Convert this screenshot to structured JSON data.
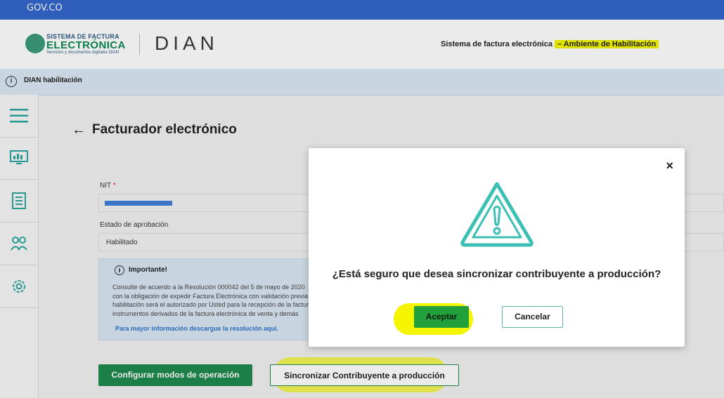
{
  "gov": {
    "label": "GOV.CO"
  },
  "header": {
    "brand_line1": "SISTEMA DE FACTURA",
    "brand_line2": "ELECTRÓNICA",
    "brand_line3": "Servicios y documentos digitales DIAN",
    "dian": "DIAN",
    "subtitle_a": "Sistema de factura electrónica",
    "subtitle_b": "– Ambiente de Habilitación"
  },
  "infobar": {
    "text": "DIAN habilitación"
  },
  "page": {
    "title": "Facturador electrónico"
  },
  "form": {
    "nit_label": "NIT",
    "nit_required": "*",
    "estado_label": "Estado de aprobación",
    "estado_value": "Habilitado"
  },
  "important": {
    "title": "Importante!",
    "line1": "Consulte de acuerdo a la Resolución 000042 del 5 de mayo de 2020",
    "line2": "con la obligación de expedir Factura Electrónica con validación previa",
    "line3": "habilitación será el autorizado por Usted para la recepción de la factura",
    "line4": "instrumentos derivados de la factura electrónica de venta y demás",
    "link": "Para mayor información descargue la resolución aquí."
  },
  "actions": {
    "configure": "Configurar modos de operación",
    "sync": "Sincronizar Contribuyente a producción"
  },
  "modal": {
    "question": "¿Está seguro que desea sincronizar contribuyente a producción?",
    "accept": "Aceptar",
    "cancel": "Cancelar",
    "close": "×"
  },
  "colors": {
    "accent": "#3cc0b4",
    "green": "#1f8a4e",
    "gov": "#3366cc"
  }
}
